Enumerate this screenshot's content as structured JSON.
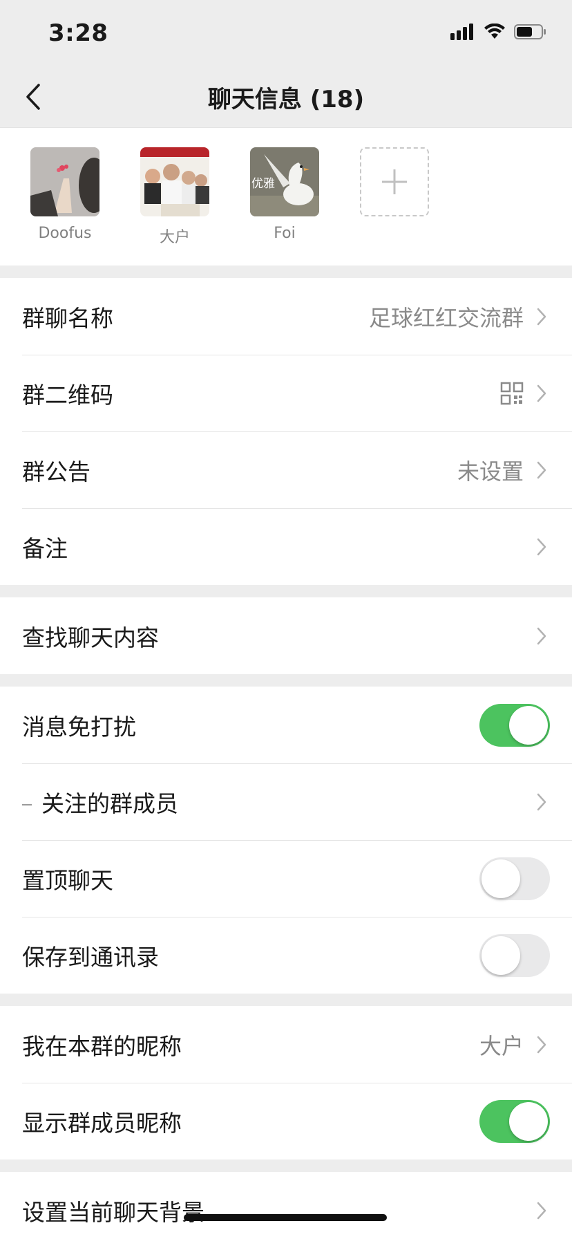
{
  "status": {
    "time": "3:28"
  },
  "nav": {
    "title": "聊天信息 (18)"
  },
  "members": [
    {
      "name": "Doofus"
    },
    {
      "name": "大户"
    },
    {
      "name": "Foi",
      "avatar_text": "优雅"
    }
  ],
  "section1": {
    "group_name": {
      "label": "群聊名称",
      "value": "足球红红交流群"
    },
    "qr_code": {
      "label": "群二维码"
    },
    "announcement": {
      "label": "群公告",
      "value": "未设置"
    },
    "remark": {
      "label": "备注"
    }
  },
  "section2": {
    "search": {
      "label": "查找聊天内容"
    }
  },
  "section3": {
    "mute": {
      "label": "消息免打扰",
      "on": true
    },
    "followed": {
      "label": "关注的群成员"
    },
    "pin": {
      "label": "置顶聊天",
      "on": false
    },
    "save_contacts": {
      "label": "保存到通讯录",
      "on": false
    }
  },
  "section4": {
    "my_nickname": {
      "label": "我在本群的昵称",
      "value": "大户"
    },
    "show_nicknames": {
      "label": "显示群成员昵称",
      "on": true
    }
  },
  "section5": {
    "background": {
      "label": "设置当前聊天背景"
    }
  },
  "colors": {
    "toggle_on": "#4cc35f",
    "toggle_off": "#e9e9ea",
    "background": "#ededed"
  }
}
